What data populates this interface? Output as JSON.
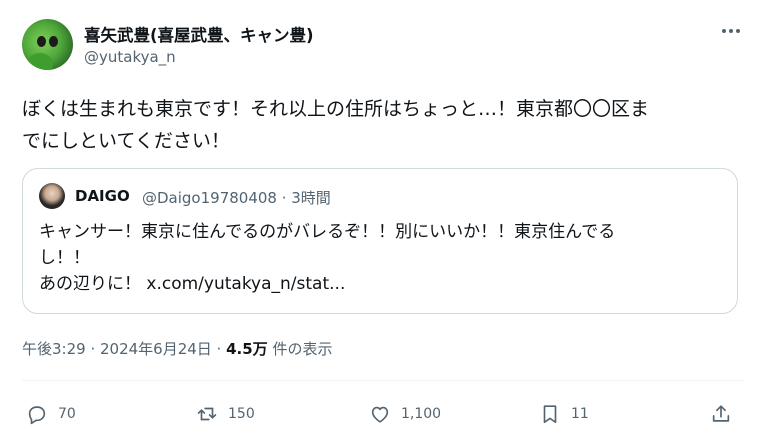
{
  "author": {
    "display_name": "喜矢武豊(喜屋武豊、キャン豊)",
    "handle": "@yutakya_n"
  },
  "tweet": {
    "text_line1": "ぼくは生まれも東京です！それ以上の住所はちょっと…！東京都〇〇区ま",
    "text_line2": "でにしといてください！"
  },
  "quote": {
    "author_name": "DAIGO",
    "meta": "@Daigo19780408 · 3時間",
    "line1": "キャンサー！東京に住んでるのがバレるぞ！！別にいいか！！東京住んでる",
    "line2": "し！！",
    "line3": "あの辺りに！ x.com/yutakya_n/stat..."
  },
  "meta": {
    "timestamp": "午後3:29 · 2024年6月24日 · ",
    "views_count": "4.5万",
    "views_label": " 件の表示"
  },
  "actions": {
    "replies": "70",
    "reposts": "150",
    "likes": "1,100",
    "bookmarks": "11"
  },
  "icons": {
    "more": "more-horiz-icon",
    "reply": "reply-icon",
    "repost": "repost-icon",
    "like": "heart-icon",
    "bookmark": "bookmark-icon",
    "share": "share-icon"
  }
}
